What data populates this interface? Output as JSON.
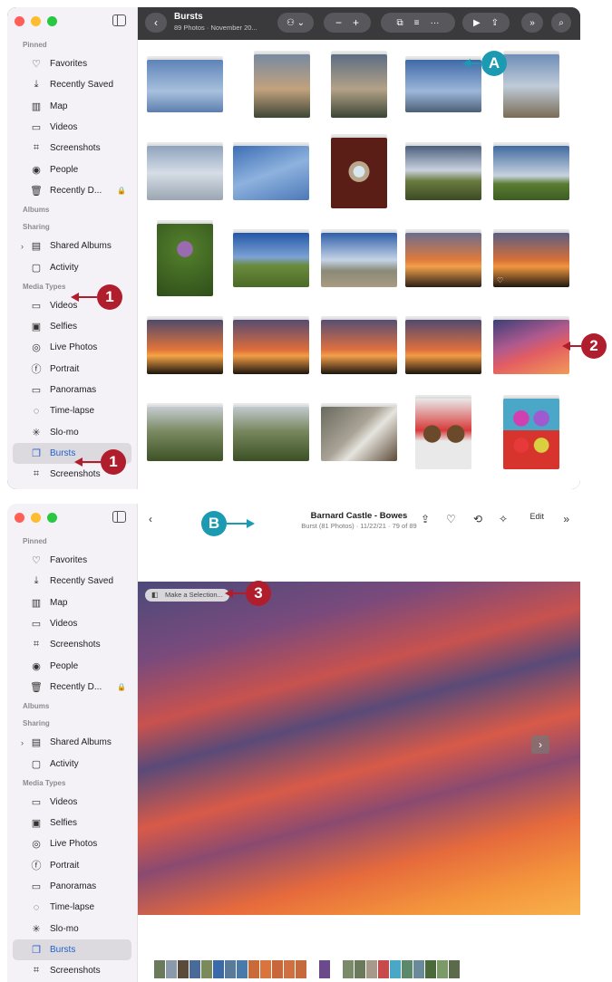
{
  "sidebar": {
    "sections": {
      "pinned": "Pinned",
      "albums": "Albums",
      "sharing": "Sharing",
      "media_types": "Media Types"
    },
    "items": {
      "favorites": "Favorites",
      "recently_saved": "Recently Saved",
      "map": "Map",
      "videos": "Videos",
      "screenshots": "Screenshots",
      "people": "People",
      "recently_deleted": "Recently D...",
      "shared_albums": "Shared Albums",
      "activity": "Activity",
      "videos_media": "Videos",
      "selfies": "Selfies",
      "live_photos": "Live Photos",
      "portrait": "Portrait",
      "panoramas": "Panoramas",
      "time_lapse": "Time-lapse",
      "slo_mo": "Slo-mo",
      "bursts": "Bursts",
      "screenshots_media": "Screenshots"
    }
  },
  "window1": {
    "title": "Bursts",
    "subtitle": "89 Photos · November 20...",
    "zoom_out": "−",
    "zoom_in": "+"
  },
  "window2": {
    "title": "Barnard Castle - Bowes",
    "subtitle": "Burst (81 Photos) · 11/22/21 · 79 of 89",
    "edit_label": "Edit",
    "make_selection": "Make a Selection..."
  },
  "callouts": {
    "a": "A",
    "b": "B",
    "one": "1",
    "two": "2",
    "three": "3"
  },
  "colors": {
    "callout_red": "#b01e2d",
    "callout_teal": "#1b9ab1",
    "selection_blue": "#2060d0"
  }
}
